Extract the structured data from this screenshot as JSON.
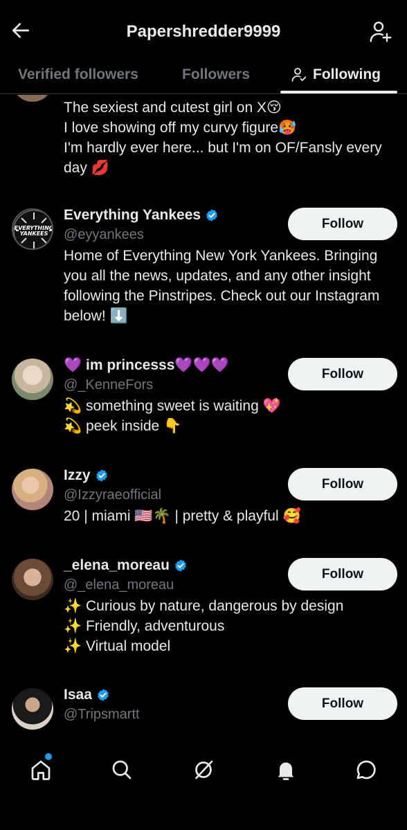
{
  "header": {
    "title": "Papershredder9999",
    "back_icon": "arrow-left-icon",
    "add_user_icon": "add-user-icon"
  },
  "tabs": [
    {
      "label": "Verified followers",
      "active": false
    },
    {
      "label": "Followers",
      "active": false
    },
    {
      "label": "Following",
      "active": true
    }
  ],
  "partial_item": {
    "bio_lines": [
      "The sexiest and cutest girl on X😚",
      "I love showing off my curvy figure🥵",
      "I'm hardly ever here... but I'm on OF/Fansly every day 💋"
    ]
  },
  "accounts": [
    {
      "name": "Everything Yankees",
      "verified": true,
      "handle": "@eyyankees",
      "bio": "Home of Everything New York Yankees. Bringing you all the news, updates, and any other insight following the Pinstripes. Check out our Instagram below! ⬇️",
      "avatar_text": "EVERYTHING YANKEES",
      "follow_label": "Follow"
    },
    {
      "name": "💜 im princesss💜💜💜",
      "verified": false,
      "handle": "@_KenneFors",
      "bio_lines": [
        "💫 something sweet is waiting 💖",
        "💫 peek inside  👇"
      ],
      "follow_label": "Follow"
    },
    {
      "name": "Izzy",
      "verified": true,
      "handle": "@Izzyraeofficial",
      "bio": "20 | miami 🇺🇸🌴 | pretty & playful 🥰",
      "follow_label": "Follow"
    },
    {
      "name": "_elena_moreau",
      "verified": true,
      "handle": "@_elena_moreau",
      "bio_lines": [
        "✨ Curious by nature, dangerous by design",
        "✨ Friendly, adventurous",
        "✨ Virtual model"
      ],
      "follow_label": "Follow"
    },
    {
      "name": "Isaa",
      "verified": true,
      "handle": "@Tripsmartt",
      "follow_label": "Follow"
    }
  ],
  "bottom_nav": {
    "items": [
      "home-icon",
      "search-icon",
      "grok-icon",
      "notifications-icon",
      "messages-icon"
    ]
  },
  "colors": {
    "background": "#000000",
    "text": "#e7e9ea",
    "muted": "#71767b",
    "accent": "#1d9bf0",
    "button_bg": "#eff3f4"
  }
}
